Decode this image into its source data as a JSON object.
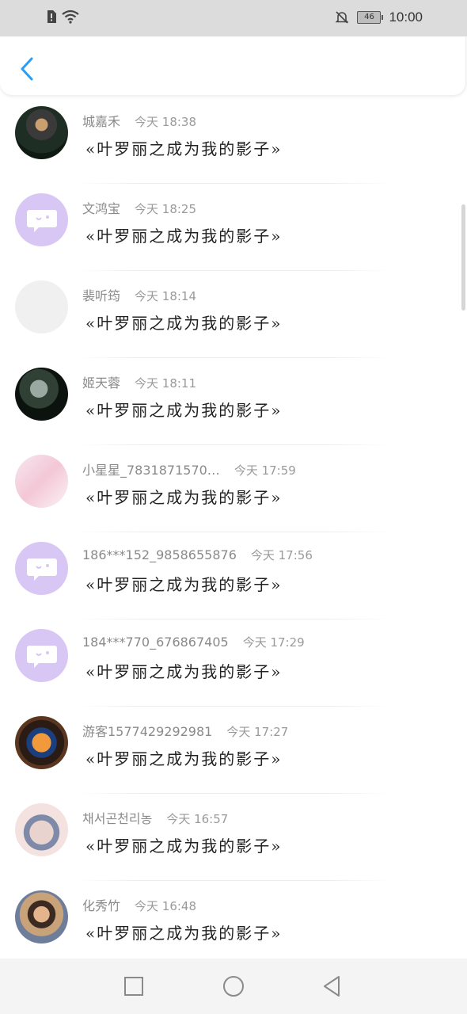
{
  "status_bar": {
    "battery": "46",
    "time": "10:00"
  },
  "messages": [
    {
      "name": "城嘉禾",
      "time": "今天 18:38",
      "text": "«叶罗丽之成为我的影子»",
      "avatar": "photo-avatar"
    },
    {
      "name": "文鸿宝",
      "time": "今天 18:25",
      "text": "«叶罗丽之成为我的影子»",
      "avatar": "default-chat-avatar"
    },
    {
      "name": "裴听筠",
      "time": "今天 18:14",
      "text": "«叶罗丽之成为我的影子»",
      "avatar": "text-avatar"
    },
    {
      "name": "姬天蓉",
      "time": "今天 18:11",
      "text": "«叶罗丽之成为我的影子»",
      "avatar": "photo-avatar"
    },
    {
      "name": "小星星_7831871570…",
      "time": "今天 17:59",
      "text": "«叶罗丽之成为我的影子»",
      "avatar": "pink-room-avatar"
    },
    {
      "name": "186***152_9858655876",
      "time": "今天 17:56",
      "text": "«叶罗丽之成为我的影子»",
      "avatar": "default-chat-avatar"
    },
    {
      "name": "184***770_676867405",
      "time": "今天 17:29",
      "text": "«叶罗丽之成为我的影子»",
      "avatar": "default-chat-avatar"
    },
    {
      "name": "游客1577429292981",
      "time": "今天 17:27",
      "text": "«叶罗丽之成为我的影子»",
      "avatar": "dog-avatar"
    },
    {
      "name": "채서곤천리농",
      "time": "今天 16:57",
      "text": "«叶罗丽之成为我的影子»",
      "avatar": "anime-avatar"
    },
    {
      "name": "化秀竹",
      "time": "今天 16:48",
      "text": "«叶罗丽之成为我的影子»",
      "avatar": "child-photo-avatar"
    }
  ],
  "colors": {
    "accent": "#2a9df4",
    "bubble_avatar": "#d8c7f4",
    "status_bar_bg": "#dcdcdc",
    "nav_bar_bg": "#f4f4f4"
  }
}
